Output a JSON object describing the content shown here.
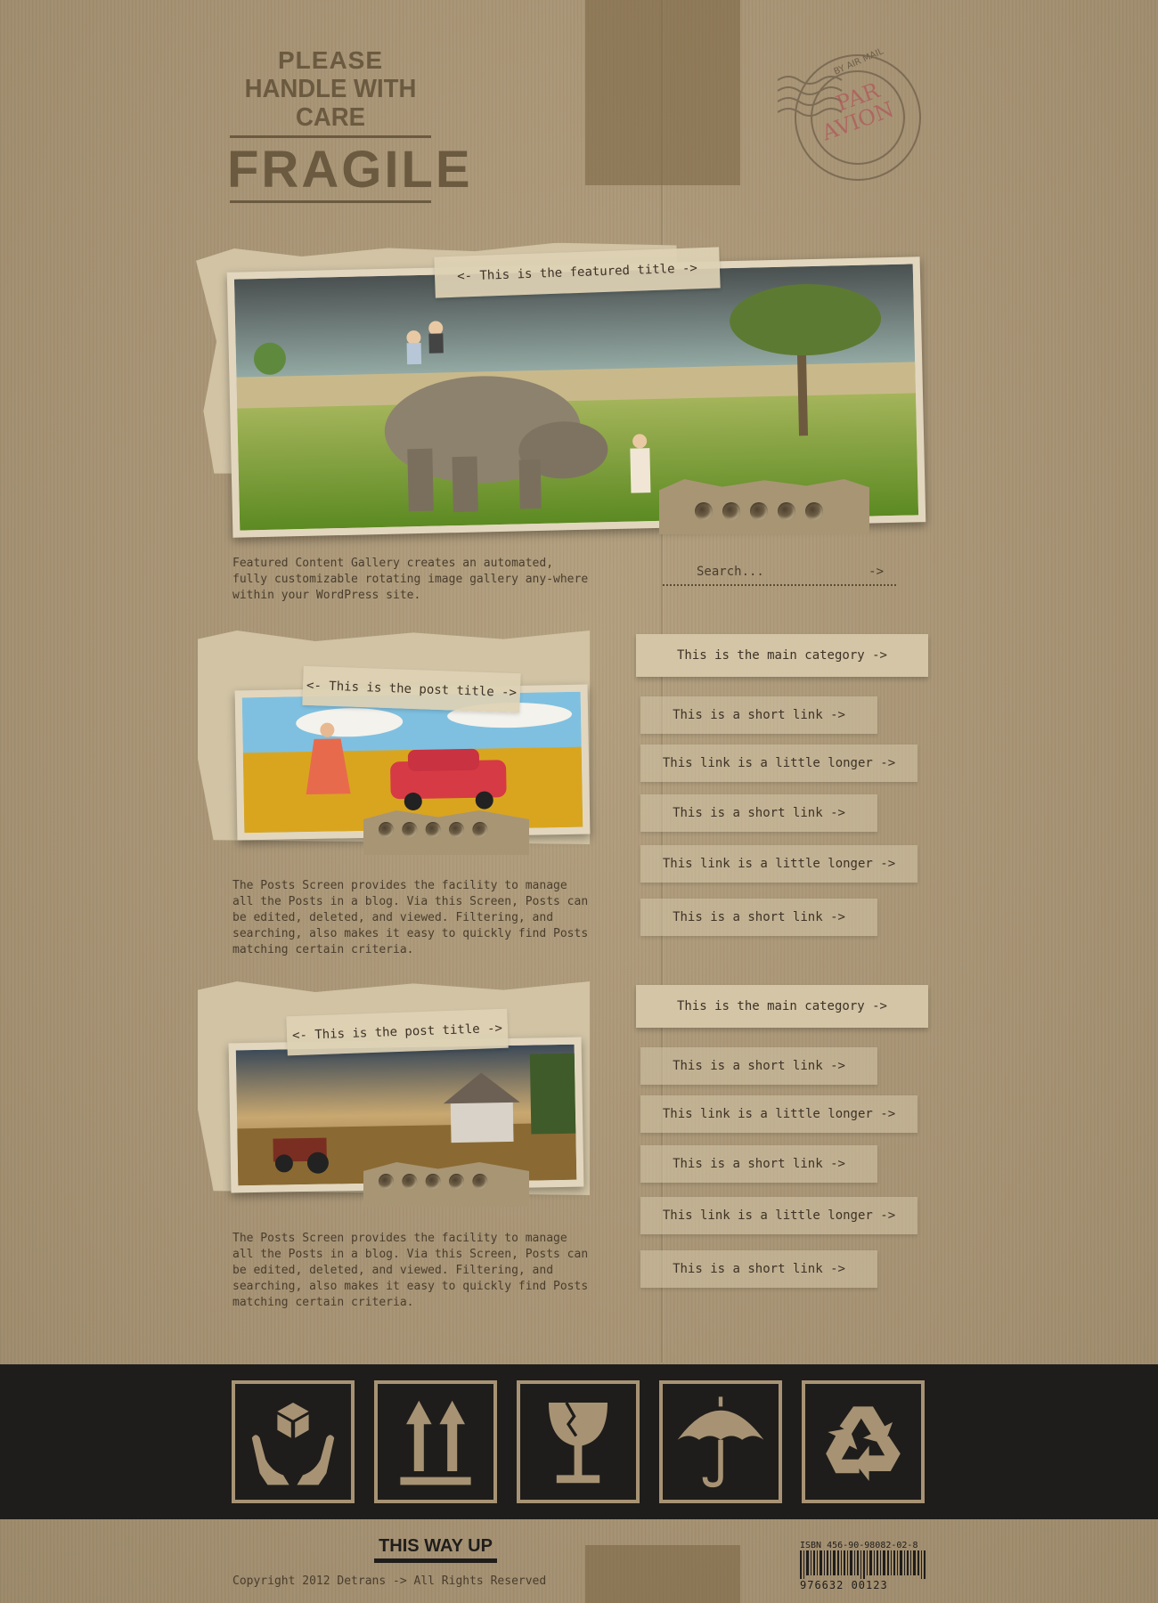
{
  "logo": {
    "line1": "PLEASE",
    "line2": "HANDLE WITH CARE",
    "line3": "FRAGILE"
  },
  "postmark": {
    "ring_text": "BY AIR MAIL",
    "line1": "PAR",
    "line2": "AVION"
  },
  "featured": {
    "title": "<- This is the featured title ->",
    "description": "Featured Content Gallery creates an automated, fully customizable rotating image gallery any-where within your WordPress site.",
    "slide_count": 5
  },
  "search": {
    "placeholder": "Search...",
    "arrow": "->"
  },
  "posts": [
    {
      "title": "<- This is the post title ->",
      "body": "The Posts Screen provides the facility to manage all the Posts in a blog. Via this Screen, Posts can be edited, deleted, and viewed. Filtering, and searching, also makes it easy to quickly find Posts matching certain criteria."
    },
    {
      "title": "<- This is the post title ->",
      "body": "The Posts Screen provides the facility to manage all the Posts in a blog. Via this Screen, Posts can be edited, deleted, and viewed. Filtering, and searching, also makes it easy to quickly find Posts matching certain criteria."
    }
  ],
  "sidebar": {
    "groups": [
      {
        "category": "This is the main category ->",
        "links": [
          "This is a short link ->",
          "This link is a little longer ->",
          "This is a short link ->",
          "This link is a little longer ->",
          "This is a short link ->"
        ]
      },
      {
        "category": "This is the main category ->",
        "links": [
          "This is a short link ->",
          "This link is a little longer ->",
          "This is a short link ->",
          "This link is a little longer ->",
          "This is a short link ->"
        ]
      }
    ]
  },
  "footer": {
    "symbols": [
      "handle-with-care-icon",
      "this-way-up-icon",
      "fragile-glass-icon",
      "keep-dry-umbrella-icon",
      "recycle-icon"
    ],
    "this_way_up": "THIS WAY UP",
    "copyright": "Copyright 2012 Detrans -> All Rights Reserved",
    "isbn_label": "ISBN",
    "isbn": "456-90-98082-02-8",
    "barcode_number": "976632 00123"
  },
  "colors": {
    "cardboard": "#a79374",
    "paper": "#d1c3a4",
    "ink": "#3d3226",
    "band": "#1f1d1b",
    "stamp_red": "#b0585a"
  }
}
